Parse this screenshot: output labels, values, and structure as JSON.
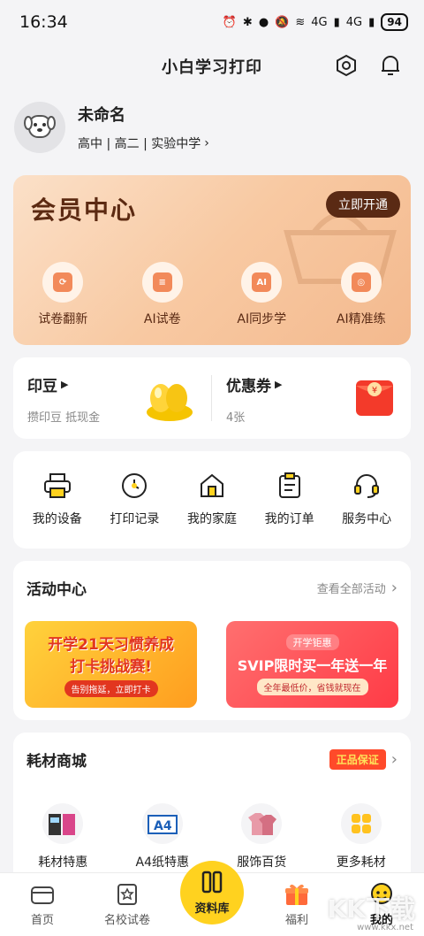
{
  "status_bar": {
    "time": "16:34",
    "signal_1": "4G",
    "signal_2": "4G",
    "battery": "94"
  },
  "header": {
    "title": "小白学习打印"
  },
  "profile": {
    "name": "未命名",
    "info": "高中 | 高二 | 实验中学"
  },
  "member": {
    "title": "会员中心",
    "open_button": "立即开通",
    "features": [
      {
        "label": "试卷翻新",
        "icon": "paper-refresh-icon"
      },
      {
        "label": "AI试卷",
        "icon": "ai-paper-icon"
      },
      {
        "label": "AI同步学",
        "icon": "ai-sync-icon",
        "badge": "AI"
      },
      {
        "label": "AI精准练",
        "icon": "target-icon"
      }
    ],
    "colors": {
      "accent": "#5a2a14",
      "icon": "#f28a5a"
    }
  },
  "points": {
    "beans_title": "印豆",
    "beans_sub": "攒印豆 抵现金",
    "coupon_title": "优惠券",
    "coupon_sub": "4张",
    "coupon_symbol": "¥"
  },
  "services": [
    {
      "label": "我的设备",
      "icon": "printer-icon"
    },
    {
      "label": "打印记录",
      "icon": "clock-icon"
    },
    {
      "label": "我的家庭",
      "icon": "home-icon"
    },
    {
      "label": "我的订单",
      "icon": "order-icon"
    },
    {
      "label": "服务中心",
      "icon": "headset-icon"
    }
  ],
  "activity": {
    "title": "活动中心",
    "more": "查看全部活动",
    "banner_left": {
      "line1": "开学21天习惯养成",
      "line2": "打卡挑战赛!",
      "pill": "告别拖延，立即打卡"
    },
    "banner_right": {
      "top": "开学钜惠",
      "main": "SVIP限时买一年送一年",
      "sub": "全年最低价，省钱就现在"
    }
  },
  "shop": {
    "title": "耗材商城",
    "badge": "正品保证",
    "items": [
      {
        "label": "耗材特惠",
        "icon": "ink-cartridge-icon"
      },
      {
        "label": "A4纸特惠",
        "icon": "a4-paper-icon"
      },
      {
        "label": "服饰百货",
        "icon": "tshirt-icon"
      },
      {
        "label": "更多耗材",
        "icon": "grid-icon"
      }
    ]
  },
  "tab_bar": {
    "tabs": [
      {
        "label": "首页",
        "icon": "home-tab-icon"
      },
      {
        "label": "名校试卷",
        "icon": "exam-tab-icon"
      },
      {
        "label": "资料库",
        "icon": "library-tab-icon"
      },
      {
        "label": "福利",
        "icon": "gift-tab-icon"
      },
      {
        "label": "我的",
        "icon": "profile-tab-icon"
      }
    ],
    "active": "我的",
    "colors": {
      "center": "#ffd21f"
    }
  },
  "watermark": {
    "text": "KK下载",
    "url": "www.kkx.net"
  }
}
